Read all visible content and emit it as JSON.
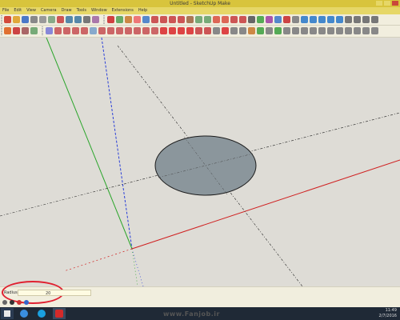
{
  "window": {
    "title": "Untitled - SketchUp Make"
  },
  "menu": [
    "File",
    "Edit",
    "View",
    "Camera",
    "Draw",
    "Tools",
    "Window",
    "Extensions",
    "Help"
  ],
  "status": {
    "measurements_label": "Radius",
    "measurements_value": "20"
  },
  "taskbar": {
    "time": "11:49",
    "date": "2/7/2016"
  },
  "watermark": "www.Fanjob.ir",
  "colors": {
    "title_bar": "#d8c43c",
    "toolbar_bg": "#f1eede",
    "viewport_bg": "#dedcd6",
    "circle_fill": "#8b969c",
    "annotation": "#e02030"
  }
}
